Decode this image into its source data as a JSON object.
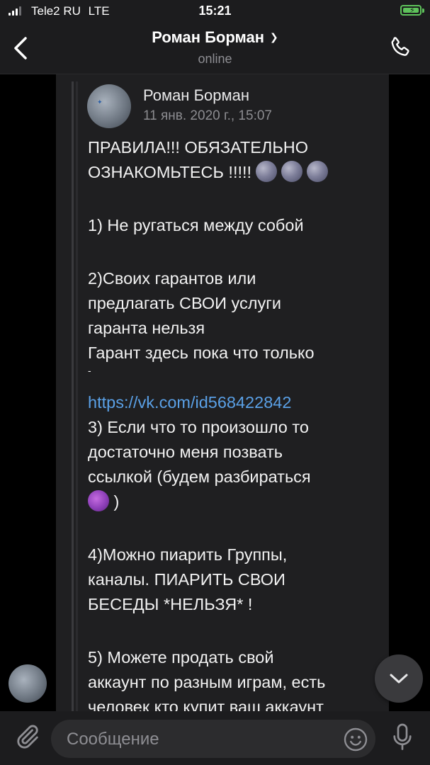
{
  "status_bar": {
    "carrier": "Tele2 RU",
    "network": "LTE",
    "time": "15:21"
  },
  "header": {
    "title": "Роман Борман",
    "subtitle": "online"
  },
  "forwarded": {
    "author": "Роман Борман",
    "date": "11 янв. 2020 г., 15:07",
    "lines": {
      "l1": "ПРАВИЛА!!! ОБЯЗАТЕЛЬНО",
      "l2": "ОЗНАКОМЬТЕСЬ !!!!!",
      "l3": "1) Не ругаться между собой",
      "l4": "2)Своих гарантов или",
      "l5": "предлагать СВОИ услуги",
      "l6": "гаранта нельзя",
      "l7": "Гарант здесь пока что только",
      "l8": "-",
      "link": "https://vk.com/id568422842",
      "l9": "3) Если что то произошло то",
      "l10": "достаточно меня позвать",
      "l11": "ссылкой (будем разбираться",
      "l12": ")",
      "l13": "4)Можно пиарить Группы,",
      "l14": "каналы. ПИАРИТЬ СВОИ",
      "l15": "БЕСЕДЫ *НЕЛЬЗЯ* !",
      "l16": "5) Можете продать свой",
      "l17": "аккаунт по разным играм, есть",
      "l18": "человек кто купит ваш аккаунт"
    }
  },
  "composer": {
    "placeholder": "Сообщение"
  },
  "icons": {
    "back": "chevron-left-icon",
    "call": "phone-icon",
    "attach": "paperclip-icon",
    "sticker": "sticker-icon",
    "mic": "microphone-icon",
    "scroll": "chevron-down-icon"
  },
  "colors": {
    "link": "#5aa0e6",
    "battery": "#5ec25b",
    "bubble": "#1f1f21"
  }
}
